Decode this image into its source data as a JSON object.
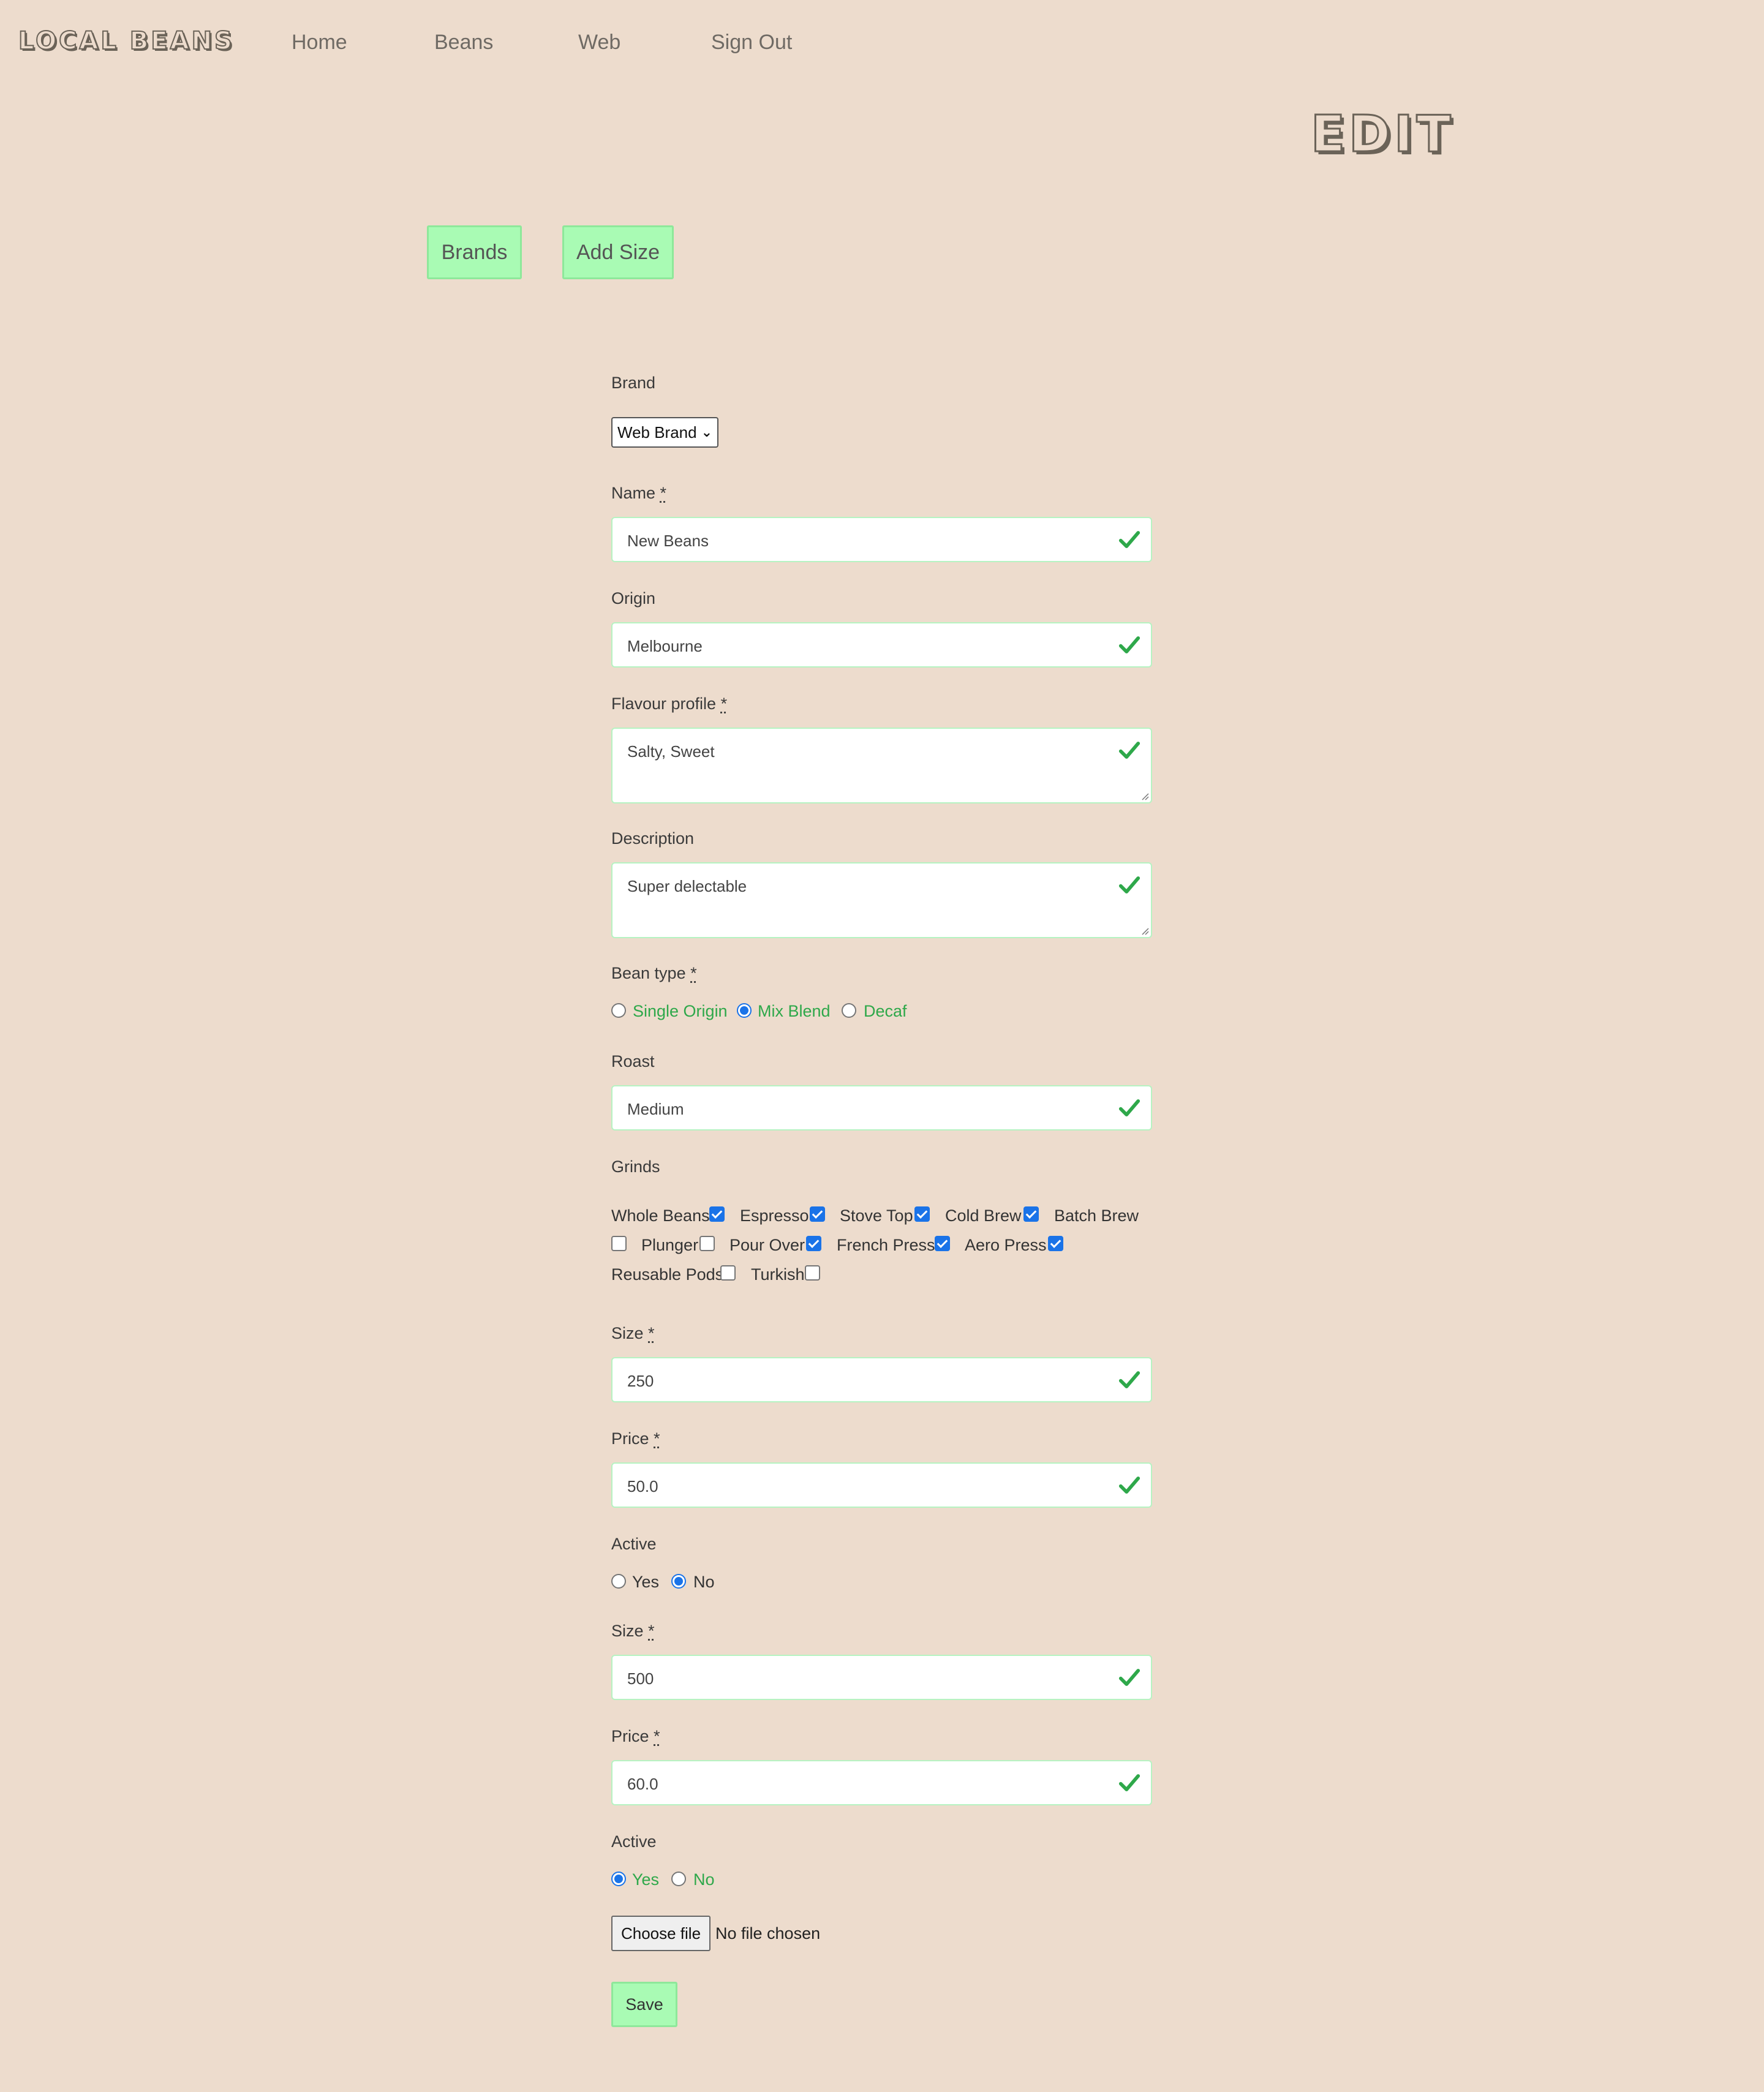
{
  "nav": {
    "logo": "LOCAL BEANS",
    "links": [
      "Home",
      "Beans",
      "Web",
      "Sign Out"
    ]
  },
  "page_title": "EDIT",
  "actions": {
    "brands": "Brands",
    "add_size": "Add Size"
  },
  "form": {
    "brand": {
      "label": "Brand",
      "value": "Web Brand"
    },
    "name": {
      "label": "Name",
      "required_mark": "*",
      "value": "New Beans"
    },
    "origin": {
      "label": "Origin",
      "value": "Melbourne"
    },
    "flavour": {
      "label": "Flavour profile",
      "required_mark": "*",
      "value": "Salty, Sweet"
    },
    "description": {
      "label": "Description",
      "value": "Super delectable"
    },
    "bean_type": {
      "label": "Bean type",
      "required_mark": "*",
      "options": [
        "Single Origin",
        "Mix Blend",
        "Decaf"
      ],
      "selected": "Mix Blend"
    },
    "roast": {
      "label": "Roast",
      "value": "Medium"
    },
    "grinds": {
      "label": "Grinds",
      "options": [
        {
          "label": "Whole Beans",
          "checked": true
        },
        {
          "label": "Espresso",
          "checked": true
        },
        {
          "label": "Stove Top",
          "checked": true
        },
        {
          "label": "Cold Brew",
          "checked": true
        },
        {
          "label": "Batch Brew",
          "checked": false
        },
        {
          "label": "Plunger",
          "checked": false
        },
        {
          "label": "Pour Over",
          "checked": true
        },
        {
          "label": "French Press",
          "checked": true
        },
        {
          "label": "Aero Press",
          "checked": true
        },
        {
          "label": "Reusable Pods",
          "checked": false
        },
        {
          "label": "Turkish",
          "checked": false
        }
      ]
    },
    "sizes": [
      {
        "size_label": "Size",
        "size_value": "250",
        "price_label": "Price",
        "price_value": "50.0",
        "active_label": "Active",
        "active_options": [
          "Yes",
          "No"
        ],
        "active_selected": "No"
      },
      {
        "size_label": "Size",
        "size_value": "500",
        "price_label": "Price",
        "price_value": "60.0",
        "active_label": "Active",
        "active_options": [
          "Yes",
          "No"
        ],
        "active_selected": "Yes"
      }
    ],
    "required_mark": "*",
    "file": {
      "button": "Choose file",
      "status": "No file chosen"
    },
    "save": "Save"
  },
  "colors": {
    "background": "#eddccd",
    "accent_green": "#a9fbb4",
    "valid_green": "#2ea84a",
    "radio_blue": "#1a73e8"
  }
}
